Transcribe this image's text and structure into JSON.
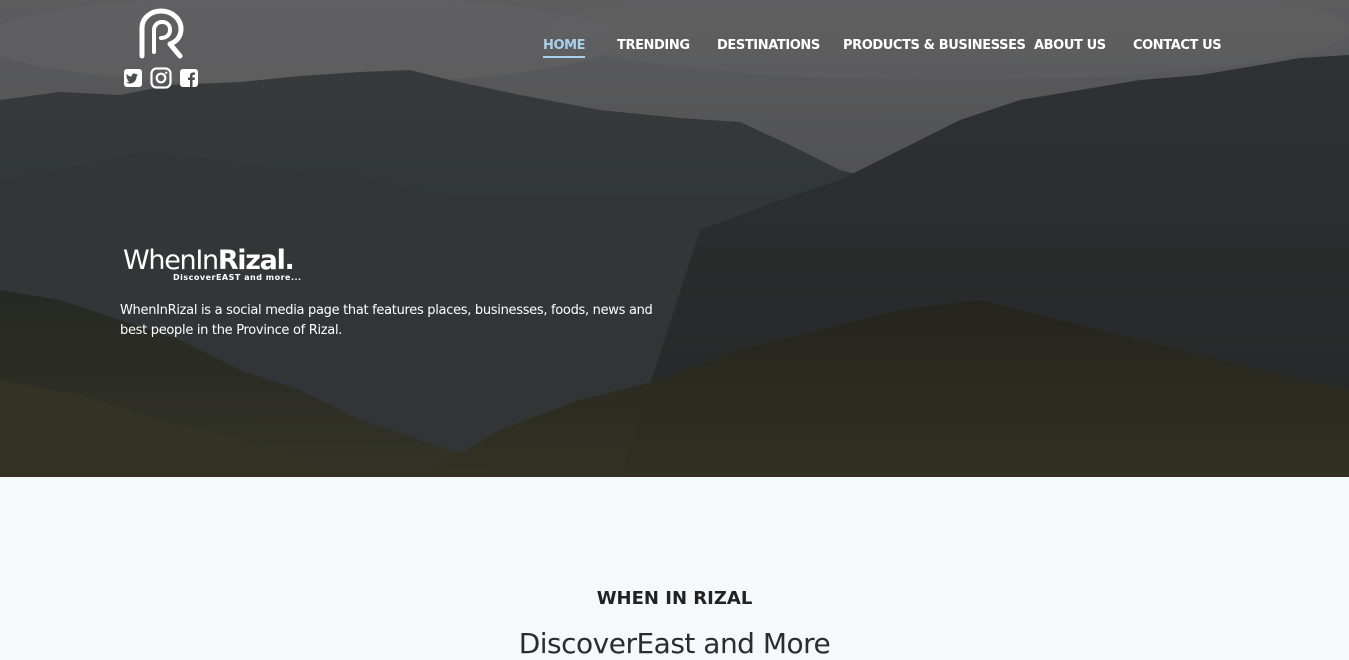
{
  "header": {
    "logo_icon": "rizal-r-logo-icon",
    "socials": [
      {
        "name": "twitter-icon"
      },
      {
        "name": "instagram-icon"
      },
      {
        "name": "facebook-icon"
      }
    ]
  },
  "nav": {
    "items": [
      {
        "label": "HOME",
        "active": true
      },
      {
        "label": "TRENDING",
        "active": false
      },
      {
        "label": "DESTINATIONS",
        "active": false
      },
      {
        "label": "PRODUCTS & BUSINESSES",
        "active": false
      },
      {
        "label": "ABOUT US",
        "active": false
      },
      {
        "label": "CONTACT US",
        "active": false
      }
    ],
    "active_color": "#a9d1ee"
  },
  "hero": {
    "brand_regular": "WhenIn",
    "brand_bold": "Rizal.",
    "tagline": "DiscoverEAST and more...",
    "description": "WhenInRizal is a social media page that features places, businesses, foods, news and best people in the Province of Rizal."
  },
  "section": {
    "heading": "WHEN IN RIZAL",
    "subheading": "DiscoverEast and More"
  }
}
